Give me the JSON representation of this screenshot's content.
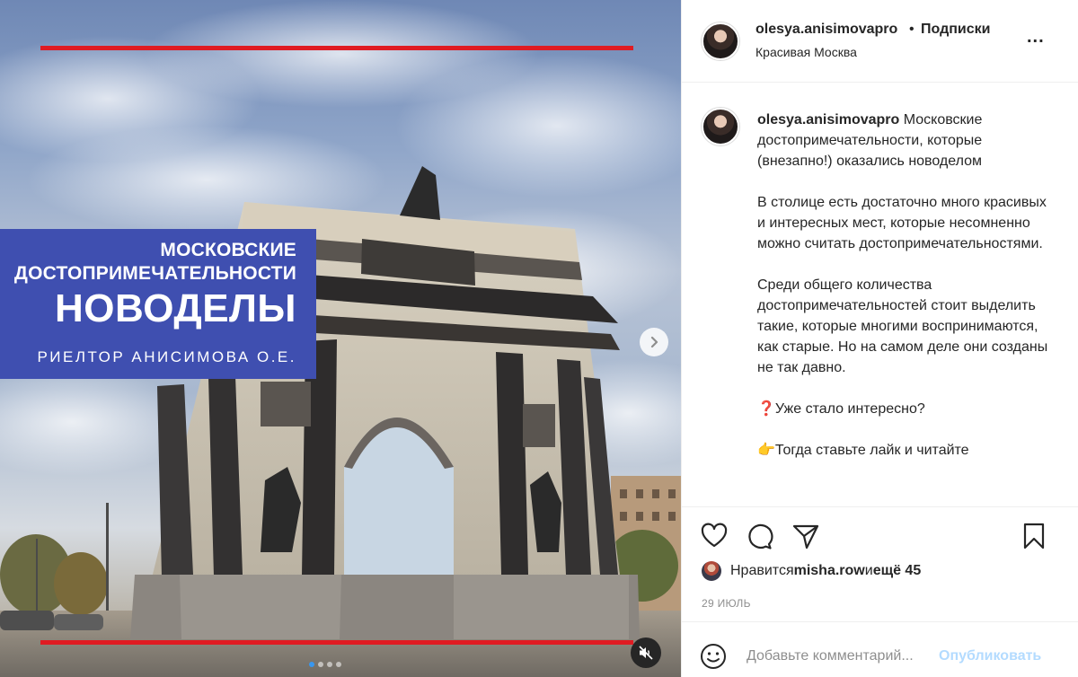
{
  "media": {
    "overlay": {
      "line1": "МОСКОВСКИЕ",
      "line2": "ДОСТОПРИМЕЧАТЕЛЬНОСТИ",
      "line3": "НОВОДЕЛЫ",
      "line4": "РИЕЛТОР АНИСИМОВА О.Е."
    },
    "slides": {
      "count": 4,
      "active": 1
    },
    "accent_red": "#e01b22",
    "panel_blue": "#3f4fb0"
  },
  "header": {
    "username": "olesya.anisimovapro",
    "separator": "•",
    "follow_label": "Подписки",
    "location": "Красивая Москва",
    "more_label": "..."
  },
  "caption": {
    "username": "olesya.anisimovapro",
    "first": " Московские достопримечательности, которые (внезапно!) оказались новоделом",
    "p2": "В столице есть достаточно много красивых и интересных мест, которые несомненно можно считать достопримечательностями.",
    "p3": "Среди общего количества достопримечательностей стоит выделить такие, которые многими воспринимаются, как старые. Но на самом деле они созданы не так давно.",
    "p4": "❓Уже стало интересно?",
    "p5": "👉Тогда ставьте лайк и читайте"
  },
  "actions": {
    "icons": [
      "heart-icon",
      "comment-icon",
      "share-icon",
      "bookmark-icon"
    ],
    "likes_prefix": "Нравится ",
    "likes_user": "misha.row",
    "likes_middle": " и ",
    "likes_more": "ещё 45",
    "date": "29 ИЮЛЬ"
  },
  "comment": {
    "placeholder": "Добавьте комментарий...",
    "post_label": "Опубликовать"
  }
}
